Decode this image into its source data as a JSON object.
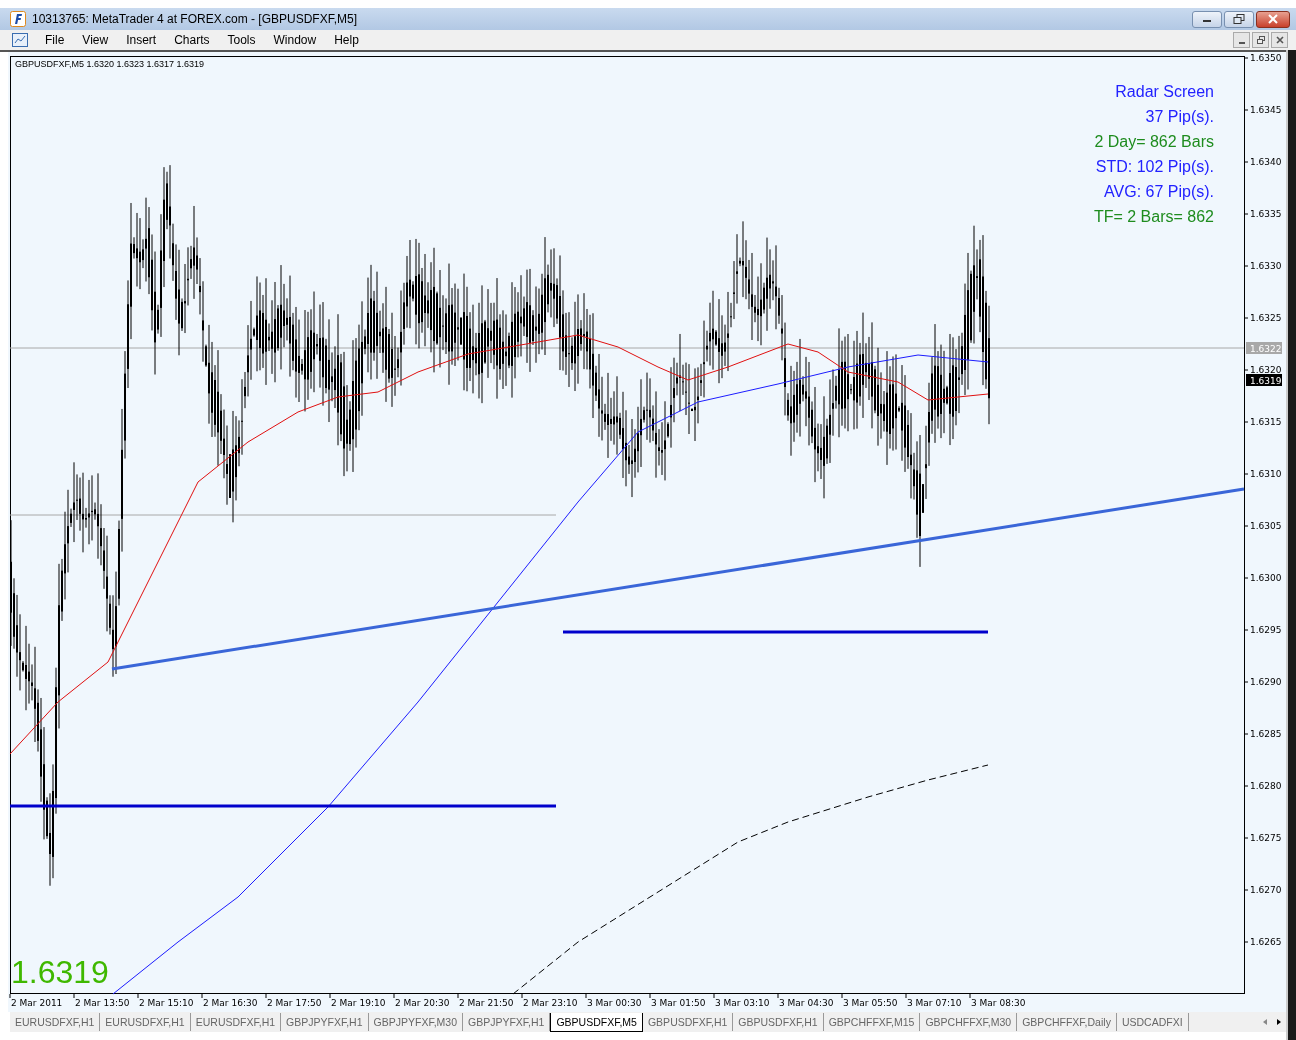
{
  "window": {
    "title": "10313765: MetaTrader 4 at FOREX.com - [GBPUSDFXF,M5]"
  },
  "menu": [
    "File",
    "View",
    "Insert",
    "Charts",
    "Tools",
    "Window",
    "Help"
  ],
  "chart": {
    "info": "GBPUSDFXF,M5  1.6320 1.6323 1.6317 1.6319",
    "radar": [
      {
        "text": "Radar Screen",
        "color": "#2222ff"
      },
      {
        "text": "37 Pip(s).",
        "color": "#2222ff"
      },
      {
        "text": "2 Day= 862 Bars",
        "color": "#1e8c1e"
      },
      {
        "text": "STD: 102 Pip(s).",
        "color": "#2222ff"
      },
      {
        "text": "AVG: 67 Pip(s).",
        "color": "#2222ff"
      },
      {
        "text": "TF= 2 Bars= 862",
        "color": "#1e8c1e"
      }
    ],
    "price_ticks": [
      "1.6350",
      "1.6345",
      "1.6340",
      "1.6335",
      "1.6330",
      "1.6325",
      "1.6320",
      "1.6315",
      "1.6310",
      "1.6305",
      "1.6300",
      "1.6295",
      "1.6290",
      "1.6285",
      "1.6280",
      "1.6275",
      "1.6270",
      "1.6265"
    ],
    "time_ticks": [
      "2 Mar 2011",
      "2 Mar 13:50",
      "2 Mar 15:10",
      "2 Mar 16:30",
      "2 Mar 17:50",
      "2 Mar 19:10",
      "2 Mar 20:30",
      "2 Mar 21:50",
      "2 Mar 23:10",
      "3 Mar 00:30",
      "3 Mar 01:50",
      "3 Mar 03:10",
      "3 Mar 04:30",
      "3 Mar 05:50",
      "3 Mar 07:10",
      "3 Mar 08:30"
    ],
    "bid_tag": "1.6322",
    "last_tag": "1.6319",
    "big_price": "1.6319"
  },
  "tabs": [
    {
      "label": "EURUSDFXF,H1",
      "selected": false
    },
    {
      "label": "EURUSDFXF,H1",
      "selected": false
    },
    {
      "label": "EURUSDFXF,H1",
      "selected": false
    },
    {
      "label": "GBPJPYFXF,H1",
      "selected": false
    },
    {
      "label": "GBPJPYFXF,M30",
      "selected": false
    },
    {
      "label": "GBPJPYFXF,H1",
      "selected": false
    },
    {
      "label": "GBPUSDFXF,M5",
      "selected": true
    },
    {
      "label": "GBPUSDFXF,H1",
      "selected": false
    },
    {
      "label": "GBPUSDFXF,H1",
      "selected": false
    },
    {
      "label": "GBPCHFFXF,M15",
      "selected": false
    },
    {
      "label": "GBPCHFFXF,M30",
      "selected": false
    },
    {
      "label": "GBPCHFFXF,Daily",
      "selected": false
    },
    {
      "label": "USDCADFXI",
      "selected": false
    }
  ]
}
